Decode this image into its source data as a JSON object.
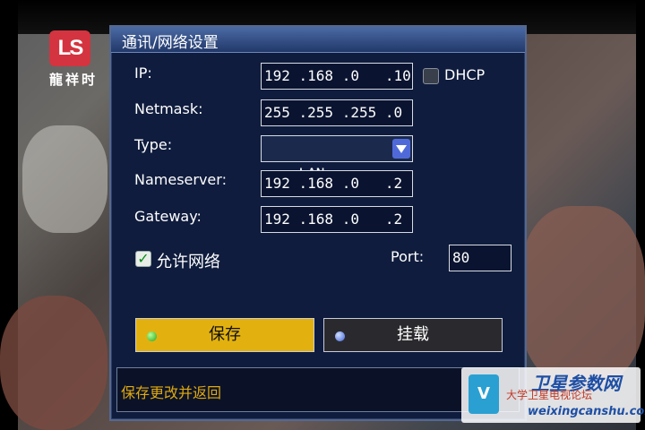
{
  "background": {
    "logo_mark": "LS",
    "logo_caption": "龍祥时"
  },
  "dialog": {
    "title": "通讯/网络设置",
    "fields": {
      "ip": {
        "label": "IP:",
        "value": "192 .168 .0   .10"
      },
      "dhcp": {
        "label": "DHCP",
        "checked": false
      },
      "netmask": {
        "label": "Netmask:",
        "value": "255 .255 .255 .0"
      },
      "type": {
        "label": "Type:",
        "value": "LAN"
      },
      "nameserver": {
        "label": "Nameserver:",
        "value": "192 .168 .0   .2"
      },
      "gateway": {
        "label": "Gateway:",
        "value": "192 .168 .0   .2"
      },
      "allow_network": {
        "label": "允许网络",
        "checked": true,
        "check_glyph": "✓"
      },
      "port": {
        "label": "Port:",
        "value": "80"
      }
    },
    "buttons": {
      "save": {
        "label": "保存",
        "dot_color": "#22a61a"
      },
      "mount": {
        "label": "挂载",
        "dot_color": "#3e5fd6"
      }
    },
    "help_text": "保存更改并返回"
  },
  "watermark": {
    "icon_glyph": "V",
    "title": "卫星参数网",
    "subtitle": "大学卫星电视论坛",
    "url": "weixingcanshu.com"
  },
  "colors": {
    "dialog_bg": "#0f1c3d",
    "title_bar": "#4b6aa5",
    "save_button": "#e3b10f",
    "help_text": "#e0a90e"
  }
}
